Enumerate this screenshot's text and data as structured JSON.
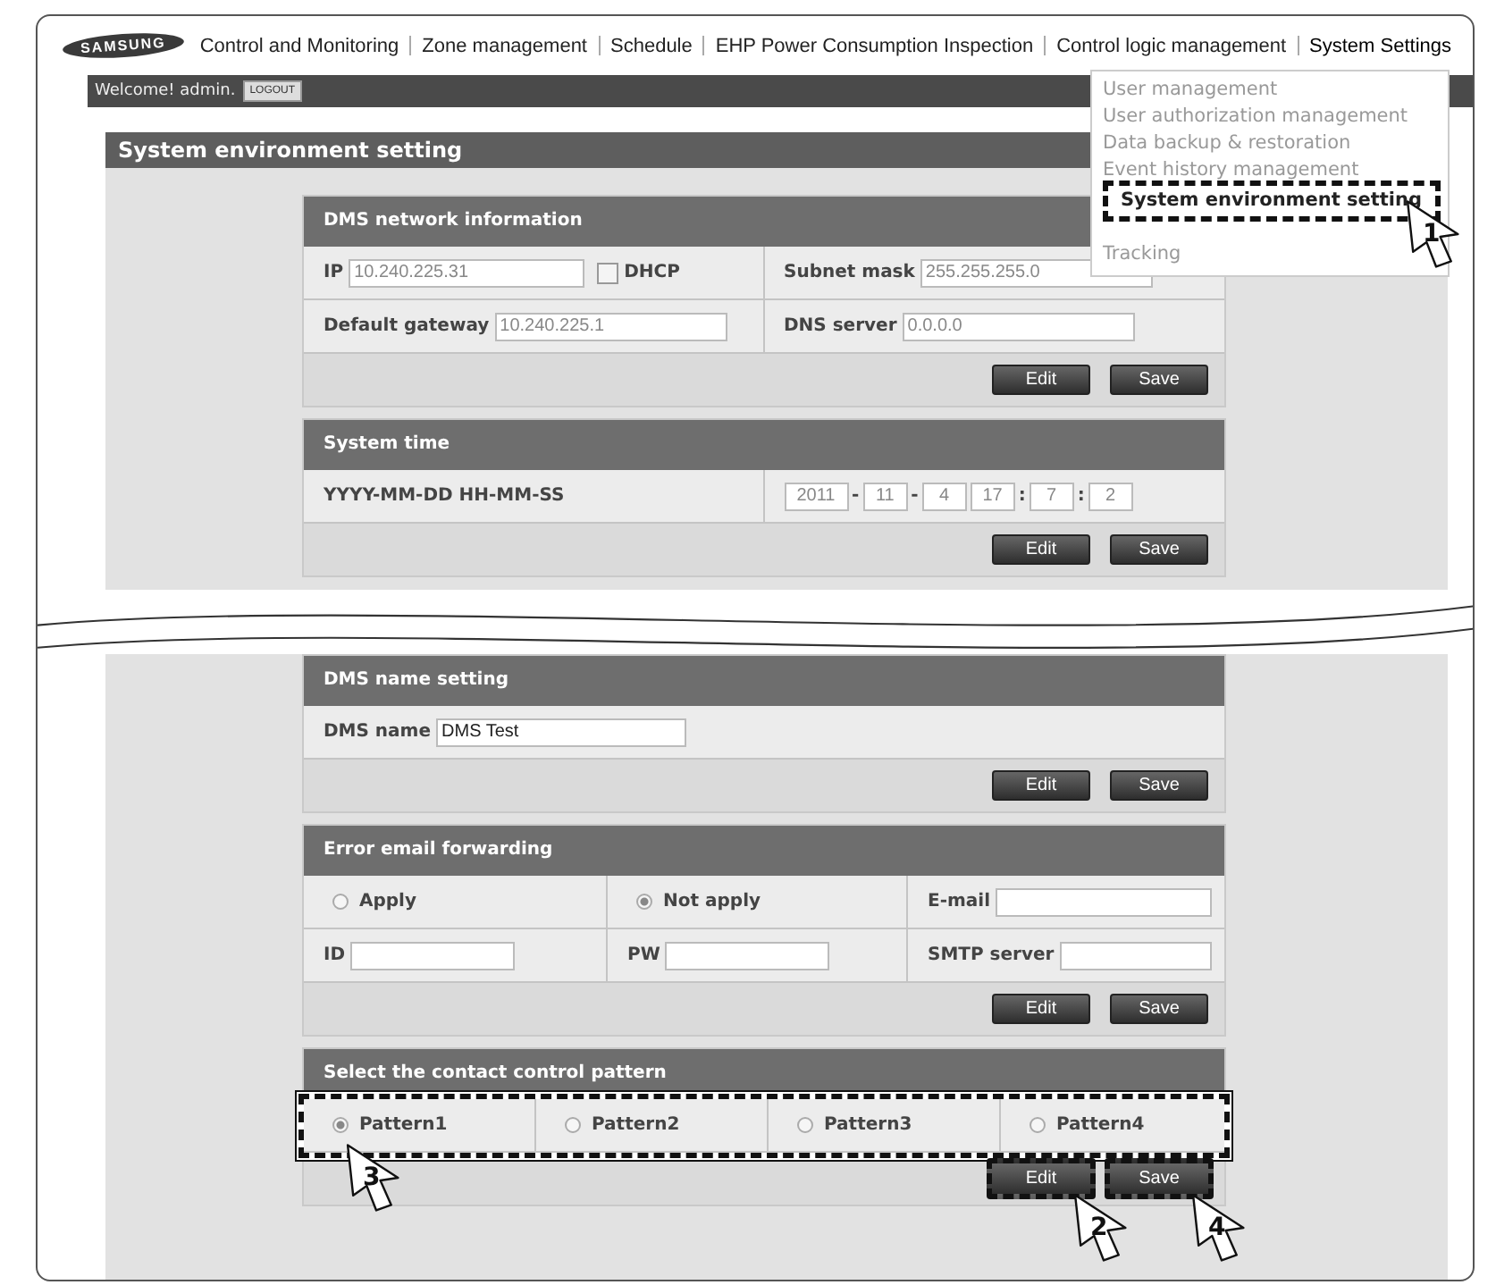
{
  "logo": "SAMSUNG",
  "nav": {
    "items": [
      {
        "label": "Control and Monitoring",
        "selected": false
      },
      {
        "label": "Zone management",
        "selected": false
      },
      {
        "label": "Schedule",
        "selected": false
      },
      {
        "label": "EHP Power Consumption Inspection",
        "selected": false
      },
      {
        "label": "Control logic management",
        "selected": false
      },
      {
        "label": "System Settings",
        "selected": true
      }
    ]
  },
  "menu": {
    "items": [
      {
        "label": "User management",
        "selected": false,
        "highlighted": false
      },
      {
        "label": "User authorization management",
        "selected": false,
        "highlighted": false
      },
      {
        "label": "Data backup & restoration",
        "selected": false,
        "highlighted": false
      },
      {
        "label": "Event history management",
        "selected": false,
        "highlighted": false
      },
      {
        "label": "System environment setting",
        "selected": true,
        "highlighted": true
      },
      {
        "label": "Tracking",
        "selected": false,
        "highlighted": false
      }
    ]
  },
  "user_bar": {
    "welcome": "Welcome! admin.",
    "logout": "LOGOUT"
  },
  "page_title": "System environment setting",
  "network": {
    "title": "DMS network information",
    "ip_label": "IP",
    "ip": "10.240.225.31",
    "dhcp_label": "DHCP",
    "dhcp_checked": false,
    "subnet_label": "Subnet mask",
    "subnet": "255.255.255.0",
    "gateway_label": "Default gateway",
    "gateway": "10.240.225.1",
    "dns_label": "DNS server",
    "dns": "0.0.0.0",
    "buttons": [
      {
        "label": "Edit",
        "highlighted": false
      },
      {
        "label": "Save",
        "highlighted": false
      }
    ]
  },
  "time": {
    "title": "System time",
    "format": "YYYY-MM-DD HH-MM-SS",
    "parts": [
      {
        "value": "2011",
        "sep": "-"
      },
      {
        "value": "11",
        "sep": "-"
      },
      {
        "value": "4"
      },
      {
        "value": "17",
        "sep": ":"
      },
      {
        "value": "7",
        "sep": ":"
      },
      {
        "value": "2"
      }
    ],
    "buttons": [
      {
        "label": "Edit",
        "highlighted": false
      },
      {
        "label": "Save",
        "highlighted": false
      }
    ]
  },
  "name": {
    "title": "DMS name setting",
    "label": "DMS name",
    "value": "DMS Test",
    "buttons": [
      {
        "label": "Edit",
        "highlighted": false
      },
      {
        "label": "Save",
        "highlighted": false
      }
    ]
  },
  "email": {
    "title": "Error email forwarding",
    "options": [
      {
        "label": "Apply",
        "selected": false
      },
      {
        "label": "Not apply",
        "selected": true
      }
    ],
    "email_label": "E-mail",
    "id_label": "ID",
    "pw_label": "PW",
    "smtp_label": "SMTP server",
    "buttons": [
      {
        "label": "Edit",
        "highlighted": false
      },
      {
        "label": "Save",
        "highlighted": false
      }
    ]
  },
  "pattern": {
    "title": "Select the contact control pattern",
    "highlighted": true,
    "options": [
      {
        "label": "Pattern1",
        "selected": true
      },
      {
        "label": "Pattern2",
        "selected": false
      },
      {
        "label": "Pattern3",
        "selected": false
      },
      {
        "label": "Pattern4",
        "selected": false
      }
    ],
    "buttons": [
      {
        "label": "Edit",
        "highlighted": true
      },
      {
        "label": "Save",
        "highlighted": true
      }
    ]
  },
  "callouts": [
    {
      "label": "1"
    },
    {
      "label": "2"
    },
    {
      "label": "3"
    },
    {
      "label": "4"
    }
  ]
}
